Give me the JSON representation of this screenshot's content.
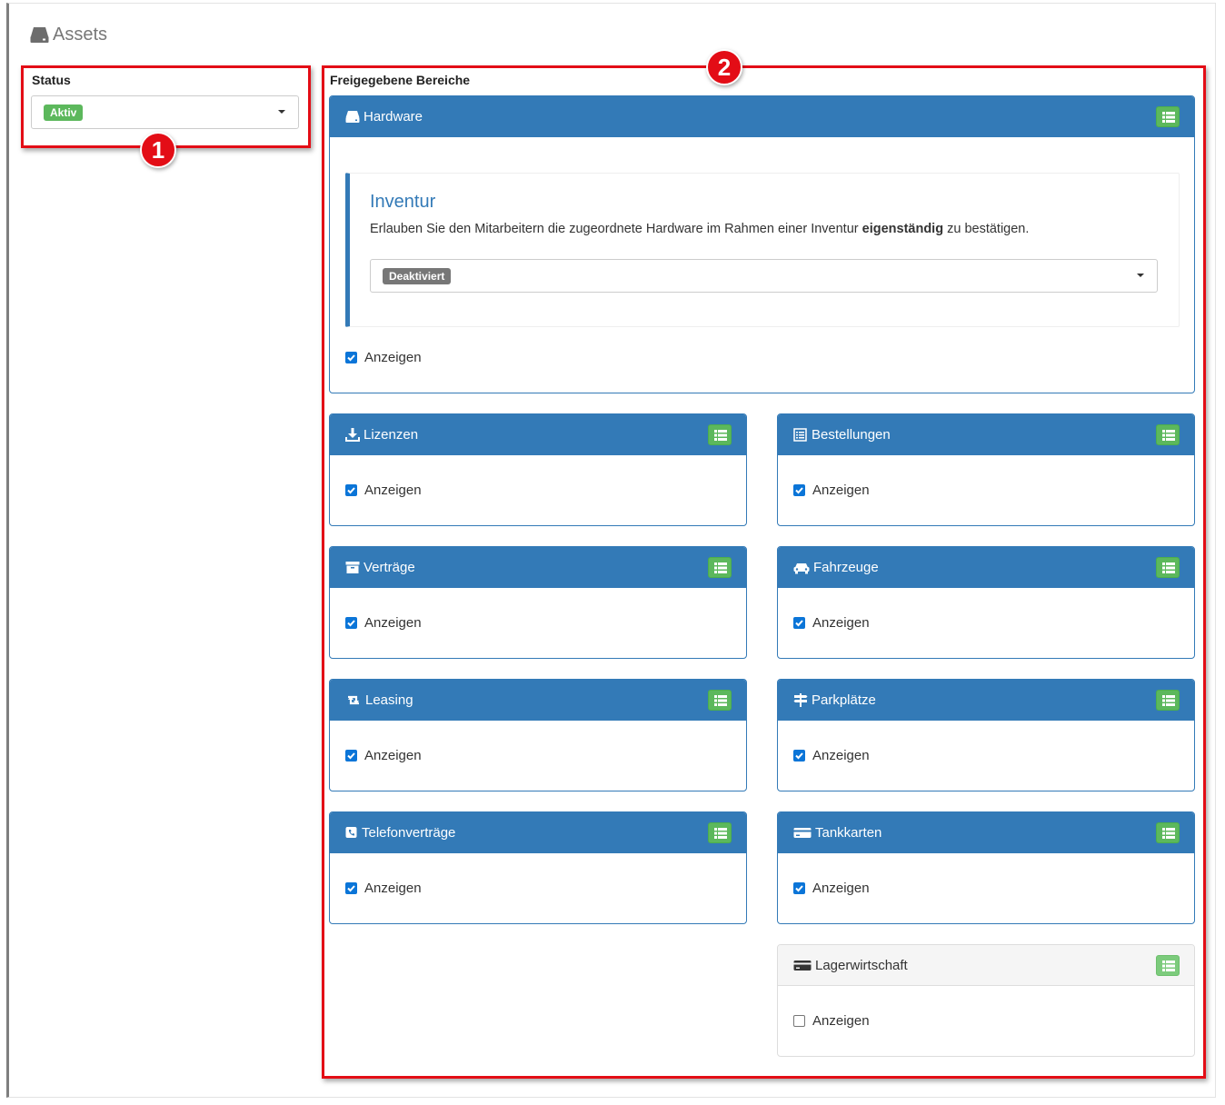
{
  "page": {
    "title": "Assets"
  },
  "status": {
    "label": "Status",
    "value": "Aktiv",
    "value_color": "#5cb85c"
  },
  "areas": {
    "label": "Freigegebene Bereiche",
    "hardware": {
      "title": "Hardware",
      "inventur": {
        "title": "Inventur",
        "desc_before": "Erlauben Sie den Mitarbeitern die zugeordnete Hardware im Rahmen einer Inventur ",
        "desc_bold": "eigenständig",
        "desc_after": " zu bestätigen.",
        "select_value": "Deaktiviert",
        "select_color": "#777777"
      },
      "show_label": "Anzeigen",
      "show_checked": true
    },
    "panels": [
      {
        "title": "Lizenzen",
        "icon": "download-icon",
        "show_label": "Anzeigen",
        "checked": true
      },
      {
        "title": "Bestellungen",
        "icon": "list-alt-icon",
        "show_label": "Anzeigen",
        "checked": true
      },
      {
        "title": "Verträge",
        "icon": "archive-icon",
        "show_label": "Anzeigen",
        "checked": true
      },
      {
        "title": "Fahrzeuge",
        "icon": "car-icon",
        "show_label": "Anzeigen",
        "checked": true
      },
      {
        "title": "Leasing",
        "icon": "retweet-icon",
        "show_label": "Anzeigen",
        "checked": true
      },
      {
        "title": "Parkplätze",
        "icon": "signpost-icon",
        "show_label": "Anzeigen",
        "checked": true
      },
      {
        "title": "Telefonverträge",
        "icon": "phone-icon",
        "show_label": "Anzeigen",
        "checked": true
      },
      {
        "title": "Tankkarten",
        "icon": "credit-card-icon",
        "show_label": "Anzeigen",
        "checked": true
      },
      {
        "title": "Lagerwirtschaft",
        "icon": "credit-card-icon",
        "show_label": "Anzeigen",
        "checked": false
      }
    ]
  },
  "annotations": [
    "1",
    "2"
  ],
  "colors": {
    "primary": "#337ab7",
    "success": "#5cb85c",
    "annotation": "#e30d16"
  }
}
